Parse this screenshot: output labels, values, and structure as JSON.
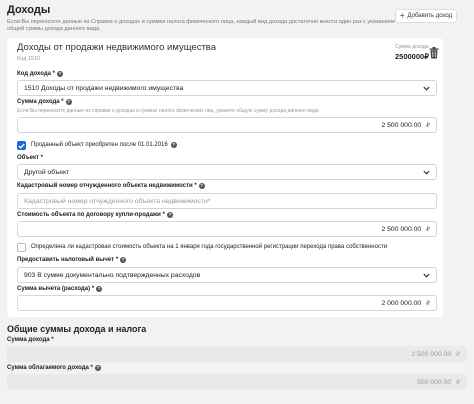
{
  "header": {
    "title": "Доходы",
    "note": "Если Вы переносите данные из Справки о доходах и суммах налога физического лица, каждый вид дохода достаточно внести один раз с указанием общей суммы дохода данного вида.",
    "add_label": "Добавить доход"
  },
  "card": {
    "title": "Доходы от продажи недвижимого имущества",
    "code": "Код 1510",
    "sum_caption": "Сумма дохода",
    "sum_value": "2500000₽"
  },
  "fields": {
    "income_code_label": "Код дохода *",
    "income_code_value": "1510 Доходы от продажи недвижимого имущества",
    "income_sum_label": "Сумма дохода *",
    "income_sum_hint": "Если Вы переносите данные из справки о доходах и суммах налога физических лиц, укажите общую сумму дохода данного вида.",
    "income_sum_value": "2 500 000.00",
    "currency": "₽",
    "acquired_after_label": "Проданный объект приобретен после 01.01.2016",
    "object_label": "Объект *",
    "object_value": "Другой объект",
    "cadastral_label": "Кадастровый номер отчужденного объекта недвижимости *",
    "cadastral_placeholder": "Кадастровый номер отчужденного объекта недвижимости*",
    "contract_value_label": "Стоимость объекта по договору купли-продажи *",
    "contract_value": "2 500 000.00",
    "cadastral_value_check_label": "Определена ли кадастровая стоимость объекта на 1 января года государственной регистрации перехода права собственности",
    "deduction_label": "Предоставить налоговый вычет *",
    "deduction_value": "903 В сумме документально подтвержденных расходов",
    "deduction_sum_label": "Сумма вычета (расхода) *",
    "deduction_sum_value": "2 000 000.00"
  },
  "totals": {
    "title": "Общие суммы дохода и налога",
    "income_label": "Сумма дохода *",
    "income_value": "2 500 000.00",
    "taxable_label": "Сумма облагаемого дохода *",
    "taxable_value": "500 000.00"
  },
  "colors": {
    "accent": "#1f66d8",
    "background": "#f2f2f2",
    "card": "#ffffff"
  }
}
